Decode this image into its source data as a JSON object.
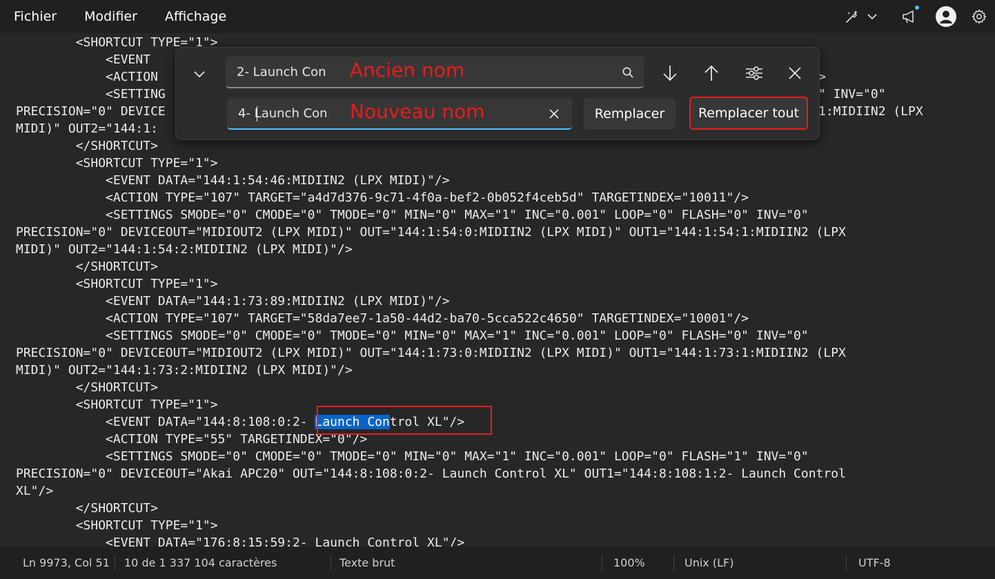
{
  "menu": {
    "items": [
      "Fichier",
      "Modifier",
      "Affichage"
    ]
  },
  "menubar_icons": [
    "copilot-icon",
    "chevron-down-icon",
    "megaphone-icon",
    "account-icon",
    "gear-icon"
  ],
  "editor": {
    "lines": [
      "        <SHORTCUT TYPE=\"1\">",
      "            <EVENT DATA=\"144:1:54:46:MIDIIN2 (LPX MIDI)\"/>",
      "            <ACTION TYPE=\"107\" TARGET=\"a4d7d376-9c71-4f0a-bef2-0b052f4ceb5d\" TARGETINDEX=\"10011\"/>",
      "            <SETTINGS SMODE=\"0\" CMODE=\"0\" TMODE=\"0\" MIN=\"0\" MAX=\"1\" INC=\"0.001\" LOOP=\"0\" FLASH=\"0\" INV=\"0\"",
      "PRECISION=\"0\" DEVICEOUT=\"MIDIOUT2 (LPX MIDI)\" OUT=\"144:1:54:0:MIDIIN2 (LPX MIDI)\" OUT1=\"144:1:54:1:MIDIIN2 (LPX",
      "MIDI)\" OUT2=\"144:1:54:2:MIDIIN2 (LPX MIDI)\"/>",
      "        </SHORTCUT>",
      "        <SHORTCUT TYPE=\"1\">",
      "            <EVENT DATA=\"144:1:73:89:MIDIIN2 (LPX MIDI)\"/>",
      "            <ACTION TYPE=\"107\" TARGET=\"58da7ee7-1a50-44d2-ba70-5cca522c4650\" TARGETINDEX=\"10001\"/>",
      "            <SETTINGS SMODE=\"0\" CMODE=\"0\" TMODE=\"0\" MIN=\"0\" MAX=\"1\" INC=\"0.001\" LOOP=\"0\" FLASH=\"0\" INV=\"0\"",
      "PRECISION=\"0\" DEVICEOUT=\"MIDIOUT2 (LPX MIDI)\" OUT=\"144:1:73:0:MIDIIN2 (LPX MIDI)\" OUT1=\"144:1:73:1:MIDIIN2 (LPX",
      "MIDI)\" OUT2=\"144:1:73:2:MIDIIN2 (LPX MIDI)\"/>",
      "        </SHORTCUT>",
      "        <SHORTCUT TYPE=\"1\">",
      "            <EVENT DATA=\"144:8:108:0:2- Launch Control XL\"/>",
      "            <ACTION TYPE=\"55\" TARGETINDEX=\"0\"/>",
      "            <SETTINGS SMODE=\"0\" CMODE=\"0\" TMODE=\"0\" MIN=\"0\" MAX=\"1\" INC=\"0.001\" LOOP=\"0\" FLASH=\"1\" INV=\"0\"",
      "PRECISION=\"0\" DEVICEOUT=\"Akai APC20\" OUT=\"144:8:108:0:2- Launch Control XL\" OUT1=\"144:8:108:1:2- Launch Control",
      "XL\"/>",
      "        </SHORTCUT>",
      "        <SHORTCUT TYPE=\"1\">",
      "            <EVENT DATA=\"176:8:15:59:2- Launch Control XL\"/>"
    ],
    "partial_lines": {
      "l0": "        <SHORTCUT TYPE=\"1\">",
      "l1": "            <EVENT ",
      "l2": "            <ACTION",
      "l3": "            <SETTING",
      "l3r": "\" INV=\"0\"",
      "l4": "PRECISION=\"0\" DEVICE",
      "l4r": "1:MIDIIN2 (LPX",
      "l5": "MIDI)\" OUT2=\"144:1:",
      "l2r": ">"
    },
    "selected_line": {
      "before": "            <EVENT DATA=\"144:8:108:0:2- ",
      "selected": "Launch Con",
      "after": "trol XL\"/>"
    }
  },
  "find_replace": {
    "find_value": "2- Launch Con",
    "replace_value": "4- Launch Con",
    "find_annotation": "Ancien nom",
    "replace_annotation": "Nouveau nom",
    "replace_label": "Remplacer",
    "replace_all_label": "Remplacer tout"
  },
  "statusbar": {
    "position": "Ln 9973, Col 51",
    "selection": "10 de 1 337 104 caractères",
    "format": "Texte brut",
    "zoom": "100%",
    "line_ending": "Unix (LF)",
    "encoding": "UTF-8"
  },
  "colors": {
    "annotation_red": "#e81c1c",
    "selection_blue": "#0a64c8",
    "accent": "#4cc2ff"
  }
}
